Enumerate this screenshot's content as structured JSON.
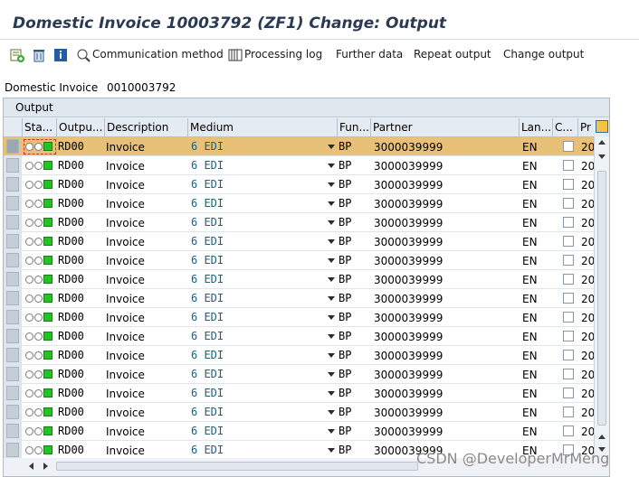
{
  "window": {
    "title": "Domestic Invoice 10003792    (ZF1) Change: Output"
  },
  "toolbar": {
    "icons": [
      "new-entry-icon",
      "delete-icon",
      "info-icon"
    ],
    "buttons": [
      "Communication method",
      "Processing log",
      "Further data",
      "Repeat output",
      "Change output"
    ]
  },
  "header": {
    "label": "Domestic Invoice",
    "value": "0010003792"
  },
  "panel": {
    "title": "Output"
  },
  "table": {
    "columns": [
      "Sta...",
      "Outpu...",
      "Description",
      "Medium",
      "Fun...",
      "Partner",
      "Lan...",
      "C...",
      "Pr"
    ],
    "rows": [
      {
        "output": "RD00",
        "description": "Invoice",
        "medium": "6 EDI",
        "function": "BP",
        "partner": "3000039999",
        "language": "EN",
        "proc": "20",
        "selected": true
      },
      {
        "output": "RD00",
        "description": "Invoice",
        "medium": "6 EDI",
        "function": "BP",
        "partner": "3000039999",
        "language": "EN",
        "proc": "20"
      },
      {
        "output": "RD00",
        "description": "Invoice",
        "medium": "6 EDI",
        "function": "BP",
        "partner": "3000039999",
        "language": "EN",
        "proc": "20"
      },
      {
        "output": "RD00",
        "description": "Invoice",
        "medium": "6 EDI",
        "function": "BP",
        "partner": "3000039999",
        "language": "EN",
        "proc": "20"
      },
      {
        "output": "RD00",
        "description": "Invoice",
        "medium": "6 EDI",
        "function": "BP",
        "partner": "3000039999",
        "language": "EN",
        "proc": "20"
      },
      {
        "output": "RD00",
        "description": "Invoice",
        "medium": "6 EDI",
        "function": "BP",
        "partner": "3000039999",
        "language": "EN",
        "proc": "20"
      },
      {
        "output": "RD00",
        "description": "Invoice",
        "medium": "6 EDI",
        "function": "BP",
        "partner": "3000039999",
        "language": "EN",
        "proc": "20"
      },
      {
        "output": "RD00",
        "description": "Invoice",
        "medium": "6 EDI",
        "function": "BP",
        "partner": "3000039999",
        "language": "EN",
        "proc": "20"
      },
      {
        "output": "RD00",
        "description": "Invoice",
        "medium": "6 EDI",
        "function": "BP",
        "partner": "3000039999",
        "language": "EN",
        "proc": "20"
      },
      {
        "output": "RD00",
        "description": "Invoice",
        "medium": "6 EDI",
        "function": "BP",
        "partner": "3000039999",
        "language": "EN",
        "proc": "20"
      },
      {
        "output": "RD00",
        "description": "Invoice",
        "medium": "6 EDI",
        "function": "BP",
        "partner": "3000039999",
        "language": "EN",
        "proc": "20"
      },
      {
        "output": "RD00",
        "description": "Invoice",
        "medium": "6 EDI",
        "function": "BP",
        "partner": "3000039999",
        "language": "EN",
        "proc": "20"
      },
      {
        "output": "RD00",
        "description": "Invoice",
        "medium": "6 EDI",
        "function": "BP",
        "partner": "3000039999",
        "language": "EN",
        "proc": "20"
      },
      {
        "output": "RD00",
        "description": "Invoice",
        "medium": "6 EDI",
        "function": "BP",
        "partner": "3000039999",
        "language": "EN",
        "proc": "20"
      },
      {
        "output": "RD00",
        "description": "Invoice",
        "medium": "6 EDI",
        "function": "BP",
        "partner": "3000039999",
        "language": "EN",
        "proc": "20"
      },
      {
        "output": "RD00",
        "description": "Invoice",
        "medium": "6 EDI",
        "function": "BP",
        "partner": "3000039999",
        "language": "EN",
        "proc": "20"
      },
      {
        "output": "RD00",
        "description": "Invoice",
        "medium": "6 EDI",
        "function": "BP",
        "partner": "3000039999",
        "language": "EN",
        "proc": "20"
      }
    ]
  },
  "watermark": "CSDN @DeveloperMrMeng",
  "colors": {
    "selected_row": "#e8c078",
    "status_green": "#22c322",
    "title": "#2a3a52"
  }
}
